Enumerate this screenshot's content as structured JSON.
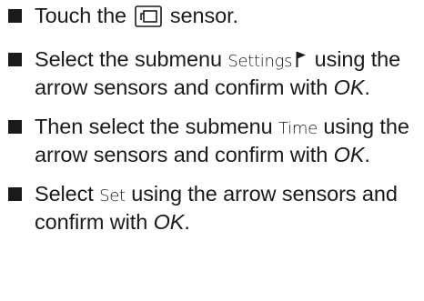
{
  "steps": [
    {
      "before": "Touch the",
      "icon": "menu-sensor-icon",
      "after": "sensor."
    },
    {
      "before": "Select the submenu",
      "term": "Settings",
      "icon": "flag-icon",
      "after": "using the arrow sensors and confirm with",
      "confirm": "OK",
      "end": "."
    },
    {
      "before": "Then select the submenu",
      "term": "Time",
      "after": "using the arrow sensors and confirm with",
      "confirm": "OK",
      "end": "."
    },
    {
      "before": "Select",
      "term": "Set",
      "after": "using the arrow sensors and confirm with",
      "confirm": "OK",
      "end": "."
    }
  ]
}
